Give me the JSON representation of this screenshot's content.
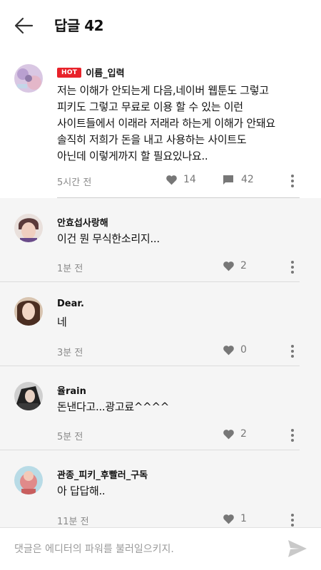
{
  "header": {
    "back_icon": "arrow-left-icon",
    "title": "답글 42"
  },
  "main_comment": {
    "badge": "HOT",
    "author": "이름_입력",
    "text": "저는 이해가 안되는게 다음,네이버 웹툰도 그렇고\n피키도 그렇고 무료로 이용 할 수 있는 이런\n사이트들에서 이래라 저래라 하는게 이해가 안돼요\n솔직히 저희가 돈을 내고 사용하는 사이트도\n아닌데 이렇게까지 할 필요있나요..",
    "time": "5시간 전",
    "likes": "14",
    "replies": "42"
  },
  "replies": [
    {
      "author": "안효섭사랑해",
      "text": "이건 뭔 무식한소리지...",
      "time": "1분 전",
      "likes": "2"
    },
    {
      "author": "Dear.",
      "text": "네",
      "time": "3분 전",
      "likes": "0"
    },
    {
      "author": "율rain",
      "text": "돈낸다고...광고료^^^^",
      "time": "5분 전",
      "likes": "2"
    },
    {
      "author": "관종_피키_후빨러_구독",
      "text": "아 답답해..",
      "time": "11분 전",
      "likes": "1"
    }
  ],
  "input": {
    "placeholder": "댓글은 에디터의 파워를 불러일으키지."
  },
  "colors": {
    "hot_badge": "#e8222a",
    "reply_background": "#f5f5f5",
    "meta_text": "#8a8a8a"
  }
}
